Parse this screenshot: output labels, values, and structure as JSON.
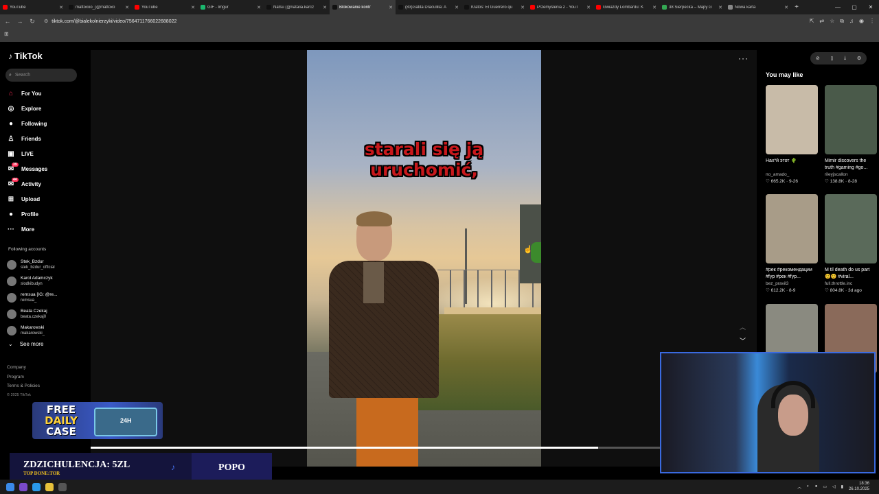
{
  "browser": {
    "tabs": [
      {
        "title": "YouTube",
        "color": "#ff0000",
        "active": false
      },
      {
        "title": "mattoxoo_(@mattoxo",
        "color": "#111111",
        "active": false
      },
      {
        "title": "YouTube",
        "color": "#ff0000",
        "active": false
      },
      {
        "title": "GIF - Imgur",
        "color": "#1bb76e",
        "active": false
      },
      {
        "title": "Natsu (@natalia.karcz",
        "color": "#111111",
        "active": false
      },
      {
        "title": "Blokowanie kontr",
        "color": "#111111",
        "active": true
      },
      {
        "title": "(83)Gatita Draculilla: A",
        "color": "#111111",
        "active": false
      },
      {
        "title": "Kratos: El Guerrero qu",
        "color": "#111111",
        "active": false
      },
      {
        "title": "Przemyślenia 2 - YouT",
        "color": "#ff0000",
        "active": false
      },
      {
        "title": "Gwiazdy Lombardu: K",
        "color": "#ff0000",
        "active": false
      },
      {
        "title": "38 Sierpecka – Mapy G",
        "color": "#34a853",
        "active": false
      },
      {
        "title": "Nowa karta",
        "color": "#888888",
        "active": false
      }
    ],
    "new_tab": "+",
    "url": "tiktok.com/@bialekolnierzyki/video/7564711766022688022"
  },
  "tiktok": {
    "logo": "TikTok",
    "search_placeholder": "Search",
    "menu": [
      {
        "label": "For You",
        "icon": "home-icon",
        "glyph": "⌂",
        "red": true
      },
      {
        "label": "Explore",
        "icon": "compass-icon",
        "glyph": "◎"
      },
      {
        "label": "Following",
        "icon": "following-avatar-icon",
        "glyph": "●"
      },
      {
        "label": "Friends",
        "icon": "friends-icon",
        "glyph": "♙"
      },
      {
        "label": "LIVE",
        "icon": "live-icon",
        "glyph": "▣"
      },
      {
        "label": "Messages",
        "icon": "messages-icon",
        "glyph": "✉",
        "badge": "39"
      },
      {
        "label": "Activity",
        "icon": "activity-icon",
        "glyph": "✉",
        "badge": "44"
      },
      {
        "label": "Upload",
        "icon": "upload-icon",
        "glyph": "⊞"
      },
      {
        "label": "Profile",
        "icon": "profile-avatar-icon",
        "glyph": "●"
      },
      {
        "label": "More",
        "icon": "more-icon",
        "glyph": "···"
      }
    ],
    "following_title": "Following accounts",
    "accounts": [
      {
        "name": "Stek_Bzdur",
        "handle": "stek_bzdur_official"
      },
      {
        "name": "Karol Adamczyk",
        "handle": "slodkibudyn"
      },
      {
        "name": "remsua [IG: @re...",
        "handle": "remsua_"
      },
      {
        "name": "Beata Czekaj",
        "handle": "beata.czekaj0"
      },
      {
        "name": "Makarowski",
        "handle": "makarowski_"
      }
    ],
    "see_more": "See more",
    "footer": [
      "Company",
      "Program",
      "Terms & Policies"
    ],
    "copyright": "© 2025 TikTok",
    "caption_line1": "starali się ją",
    "caption_line2": "uruchomić,",
    "progress": 0.89,
    "you_may_like": "You may like",
    "recommendations": [
      {
        "title": "Нах*й этот 🌵",
        "author": "no_amado_",
        "stats": "♡ 665.2K · 9-26",
        "color": "#c8bba8"
      },
      {
        "title": "Mimir discovers the truth #gaming #go...",
        "author": "rileyjscallon",
        "stats": "♡ 138.8K · 8-28",
        "color": "#4a5a4a"
      },
      {
        "title": "#рек #рекомендации #fyp #рек #fyp...",
        "author": "bez_pravil3",
        "stats": "♡ 612.2K · 8-9",
        "color": "#a89c88"
      },
      {
        "title": "M til death do us part 😊😊 #viral...",
        "author": "full.throttle.inc",
        "stats": "♡ 804.8K · 3d ago",
        "color": "#5a6a5a"
      },
      {
        "title": "",
        "author": "",
        "stats": "",
        "color": "#8a8a80"
      },
      {
        "title": "",
        "author": "",
        "stats": "",
        "color": "#8a6a5a"
      }
    ]
  },
  "overlays": {
    "case_line1": "FREE",
    "case_line2": "DAILY",
    "case_line3": "CASE",
    "case_timer": "24H",
    "donor_amount": "ZDZICHULENCJA: 5ZL",
    "donor_label": "TOP DONE:TOR",
    "donor_name": "POPO"
  },
  "taskbar": {
    "time": "18:36",
    "date": "26.10.2025"
  }
}
